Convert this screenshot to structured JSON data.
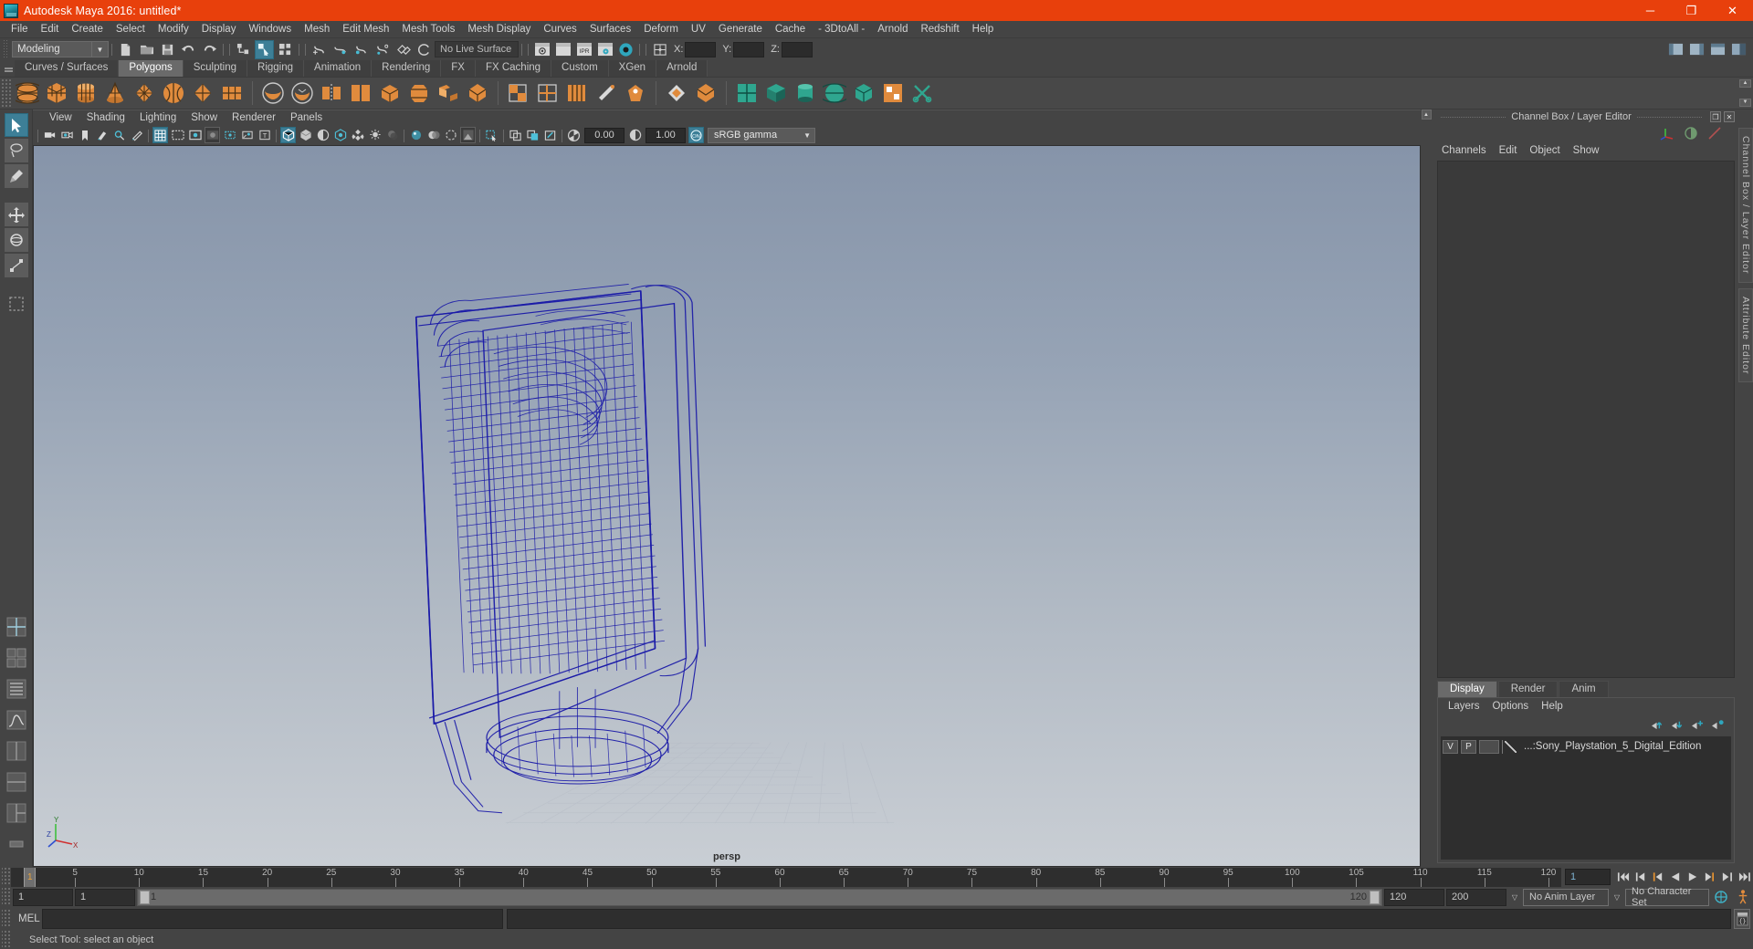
{
  "window": {
    "title": "Autodesk Maya 2016: untitled*",
    "app_icon": "maya-logo-icon",
    "minimize_label": "─",
    "maximize_label": "❐",
    "close_label": "✕",
    "titlebar_color": "#e8400c"
  },
  "menubar": {
    "items": [
      {
        "label": "File"
      },
      {
        "label": "Edit"
      },
      {
        "label": "Create"
      },
      {
        "label": "Select"
      },
      {
        "label": "Modify"
      },
      {
        "label": "Display"
      },
      {
        "label": "Windows"
      },
      {
        "label": "Mesh"
      },
      {
        "label": "Edit Mesh"
      },
      {
        "label": "Mesh Tools"
      },
      {
        "label": "Mesh Display"
      },
      {
        "label": "Curves"
      },
      {
        "label": "Surfaces"
      },
      {
        "label": "Deform"
      },
      {
        "label": "UV"
      },
      {
        "label": "Generate"
      },
      {
        "label": "Cache"
      },
      {
        "label": "- 3DtoAll -"
      },
      {
        "label": "Arnold"
      },
      {
        "label": "Redshift"
      },
      {
        "label": "Help"
      }
    ]
  },
  "statusbar": {
    "menu_set": "Modeling",
    "live_surface": "No Live Surface",
    "coord_x_label": "X:",
    "coord_y_label": "Y:",
    "coord_z_label": "Z:",
    "coord_x_value": "",
    "coord_y_value": "",
    "coord_z_value": ""
  },
  "shelf": {
    "tabs": [
      {
        "label": "Curves / Surfaces",
        "active": false
      },
      {
        "label": "Polygons",
        "active": true
      },
      {
        "label": "Sculpting",
        "active": false
      },
      {
        "label": "Rigging",
        "active": false
      },
      {
        "label": "Animation",
        "active": false
      },
      {
        "label": "Rendering",
        "active": false
      },
      {
        "label": "FX",
        "active": false
      },
      {
        "label": "FX Caching",
        "active": false
      },
      {
        "label": "Custom",
        "active": false
      },
      {
        "label": "XGen",
        "active": false
      },
      {
        "label": "Arnold",
        "active": false
      }
    ],
    "scroll_up": "▲",
    "scroll_down": "▼"
  },
  "viewport_menu": {
    "items": [
      {
        "label": "View"
      },
      {
        "label": "Shading"
      },
      {
        "label": "Lighting"
      },
      {
        "label": "Show"
      },
      {
        "label": "Renderer"
      },
      {
        "label": "Panels"
      }
    ]
  },
  "viewport_toolbar": {
    "exposure_value": "0.00",
    "gamma_value": "1.00",
    "color_management_toggle": "ON",
    "color_profile": "sRGB gamma",
    "dropdown_arrow": "▼"
  },
  "viewport": {
    "camera_label": "persp",
    "mesh_color": "#1a1aa8",
    "background_top": "#8796ab",
    "background_bottom": "#c7ccd2",
    "axis_x": "X",
    "axis_y": "Y",
    "axis_z": "Z"
  },
  "channel_box": {
    "panel_title": "Channel Box / Layer Editor",
    "restore_label": "❐",
    "close_label": "✕",
    "menu": [
      {
        "label": "Channels"
      },
      {
        "label": "Edit"
      },
      {
        "label": "Object"
      },
      {
        "label": "Show"
      }
    ]
  },
  "layer_editor": {
    "tabs": [
      {
        "label": "Display",
        "active": true
      },
      {
        "label": "Render",
        "active": false
      },
      {
        "label": "Anim",
        "active": false
      }
    ],
    "menu": [
      {
        "label": "Layers"
      },
      {
        "label": "Options"
      },
      {
        "label": "Help"
      }
    ],
    "buttons": [
      {
        "name": "move-layer-up-button"
      },
      {
        "name": "move-layer-down-button"
      },
      {
        "name": "new-layer-button"
      },
      {
        "name": "new-layer-from-selected-button"
      }
    ],
    "layers": [
      {
        "visibility": "V",
        "playback": "P",
        "name": "...:Sony_Playstation_5_Digital_Edition"
      }
    ]
  },
  "vertical_tabs": [
    {
      "label": "Channel Box / Layer Editor"
    },
    {
      "label": "Attribute Editor"
    }
  ],
  "timeline": {
    "ticks": [
      5,
      10,
      15,
      20,
      25,
      30,
      35,
      40,
      45,
      50,
      55,
      60,
      65,
      70,
      75,
      80,
      85,
      90,
      95,
      100,
      105,
      110,
      115,
      120
    ],
    "current_frame": "1",
    "start": 1,
    "end": 120,
    "current_frame_field": "1",
    "playback_end_display": "120",
    "transport": [
      {
        "name": "go-to-start-button",
        "glyph": "⏮"
      },
      {
        "name": "step-back-keyframe-button",
        "glyph": "⏪"
      },
      {
        "name": "step-back-frame-button",
        "glyph": "◀"
      },
      {
        "name": "play-backwards-button",
        "glyph": "◀"
      },
      {
        "name": "play-forwards-button",
        "glyph": "▶"
      },
      {
        "name": "step-forward-frame-button",
        "glyph": "▶"
      },
      {
        "name": "step-forward-keyframe-button",
        "glyph": "⏩"
      },
      {
        "name": "go-to-end-button",
        "glyph": "⏭"
      }
    ]
  },
  "range_slider": {
    "anim_start": "1",
    "range_start": "1",
    "bar_left_label": "1",
    "bar_right_label": "120",
    "range_end": "120",
    "anim_end": "200",
    "anim_layer": "No Anim Layer",
    "character_set": "No Character Set",
    "dropdown_arrow": "▽",
    "auto_key_icon": "auto-keyframe-icon",
    "anim_prefs_icon": "animation-preferences-icon"
  },
  "command_line": {
    "label": "MEL",
    "input_value": "",
    "output_value": "",
    "script_editor_icon": "script-editor-icon"
  },
  "help_line": {
    "message": "Select Tool: select an object"
  },
  "toolbox": {
    "tools": [
      {
        "name": "select-tool",
        "active": true
      },
      {
        "name": "lasso-select-tool",
        "active": false
      },
      {
        "name": "paint-select-tool",
        "active": false
      },
      {
        "name": "move-tool",
        "active": false
      },
      {
        "name": "rotate-tool",
        "active": false
      },
      {
        "name": "scale-tool",
        "active": false
      },
      {
        "name": "last-tool-used",
        "active": false
      }
    ],
    "layouts": [
      {
        "name": "single-perspective-layout"
      },
      {
        "name": "four-view-layout"
      },
      {
        "name": "persp-outliner-layout"
      },
      {
        "name": "persp-graph-layout"
      },
      {
        "name": "two-pane-side-layout"
      },
      {
        "name": "two-pane-stacked-layout"
      },
      {
        "name": "three-pane-layout"
      },
      {
        "name": "hypershade-layout"
      }
    ]
  }
}
